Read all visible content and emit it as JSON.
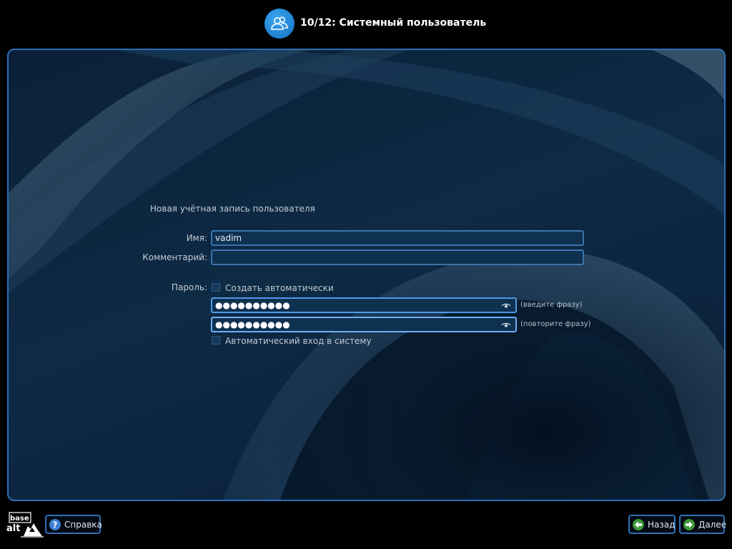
{
  "header": {
    "title": "10/12: Системный пользователь",
    "icon": "users-icon",
    "icon_color": "#2b8fe0"
  },
  "form": {
    "heading": "Новая учётная запись пользователя",
    "name_label": "Имя:",
    "name_value": "vadim",
    "comment_label": "Комментарий:",
    "comment_value": "",
    "password_label": "Пароль:",
    "auto_create_label": "Создать автоматически",
    "auto_create_checked": false,
    "password_value": "●●●●●●●●●●",
    "password_hint": "(введите фразу)",
    "password_repeat_value": "●●●●●●●●●●",
    "password_repeat_hint": "(повторите фразу)",
    "autologin_label": "Автоматический вход в систему",
    "autologin_checked": false
  },
  "footer": {
    "logo_top": "base",
    "logo_bottom": "alt",
    "help_label": "Справка",
    "back_label": "Назад",
    "next_label": "Далее"
  },
  "colors": {
    "accent": "#2f6fb6",
    "field_bg": "#0f3150",
    "background": "#000000"
  }
}
